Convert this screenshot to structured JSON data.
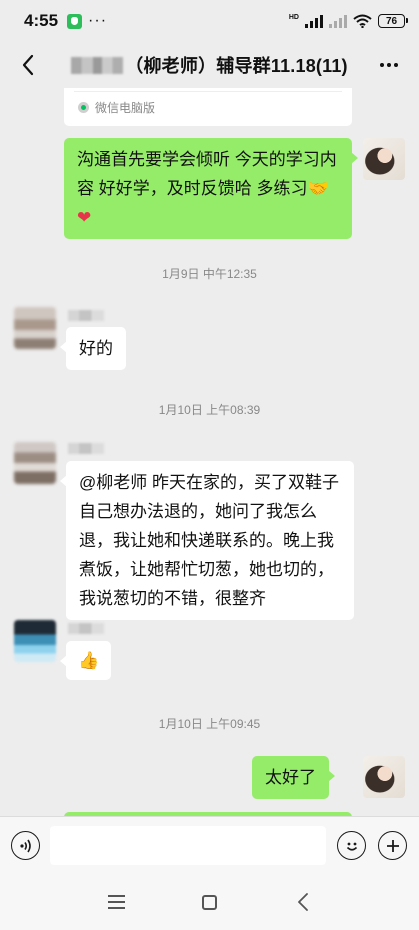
{
  "status_bar": {
    "time": "4:55",
    "dots": "···",
    "network": "HD",
    "battery": "76"
  },
  "header": {
    "title": "（柳老师）辅导群11.18(11)"
  },
  "chat": {
    "card_source": "微信电脑版",
    "messages": [
      {
        "kind": "out",
        "text": "沟通首先要学会倾听   今天的学习内容   好好学，及时反馈哈   多练习🤝",
        "heart": "❤"
      },
      {
        "kind": "time",
        "text": "1月9日 中午12:35"
      },
      {
        "kind": "in",
        "text": "好的"
      },
      {
        "kind": "time",
        "text": "1月10日 上午08:39"
      },
      {
        "kind": "in",
        "text": "@柳老师   昨天在家的，买了双鞋子自己想办法退的，她问了我怎么退，我让她和快递联系的。晚上我煮饭，让她帮忙切葱，她也切的，我说葱切的不错，很整齐"
      },
      {
        "kind": "in",
        "text": "👍"
      },
      {
        "kind": "time",
        "text": "1月10日 上午09:45"
      },
      {
        "kind": "out",
        "text": "太好了"
      }
    ]
  },
  "input_bar": {
    "value": "",
    "placeholder": ""
  },
  "icons": {
    "back": "chevron-left-icon",
    "more": "more-dots-icon",
    "voice": "voice-icon",
    "emoji": "emoji-icon",
    "plus": "plus-icon"
  },
  "colors": {
    "out_bubble": "#95ec69",
    "in_bubble": "#ffffff",
    "background": "#ededed"
  }
}
